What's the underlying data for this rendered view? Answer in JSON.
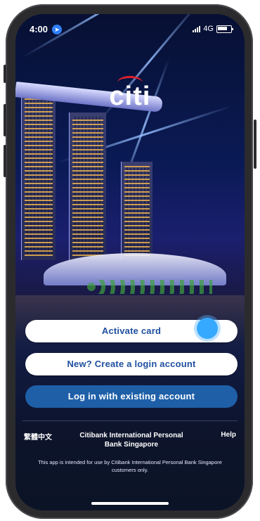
{
  "status_bar": {
    "time": "4:00",
    "network": "4G",
    "location_icon": "location-arrow-icon"
  },
  "brand": {
    "logo_text": "citi",
    "logo_arc_color": "#e0202a"
  },
  "buttons": {
    "activate_card": "Activate card",
    "create_account": "New? Create a login account",
    "login_existing": "Log in with existing account"
  },
  "footer": {
    "language": "繁體中文",
    "bank_name": "Citibank International Personal Bank Singapore",
    "help": "Help",
    "disclaimer": "This app is intended for use by Citibank International Personal Bank Singapore customers only."
  },
  "colors": {
    "primary_button": "#1e5fa8",
    "secondary_button_text": "#1f4fa0",
    "touch_indicator": "#35a9ff"
  }
}
